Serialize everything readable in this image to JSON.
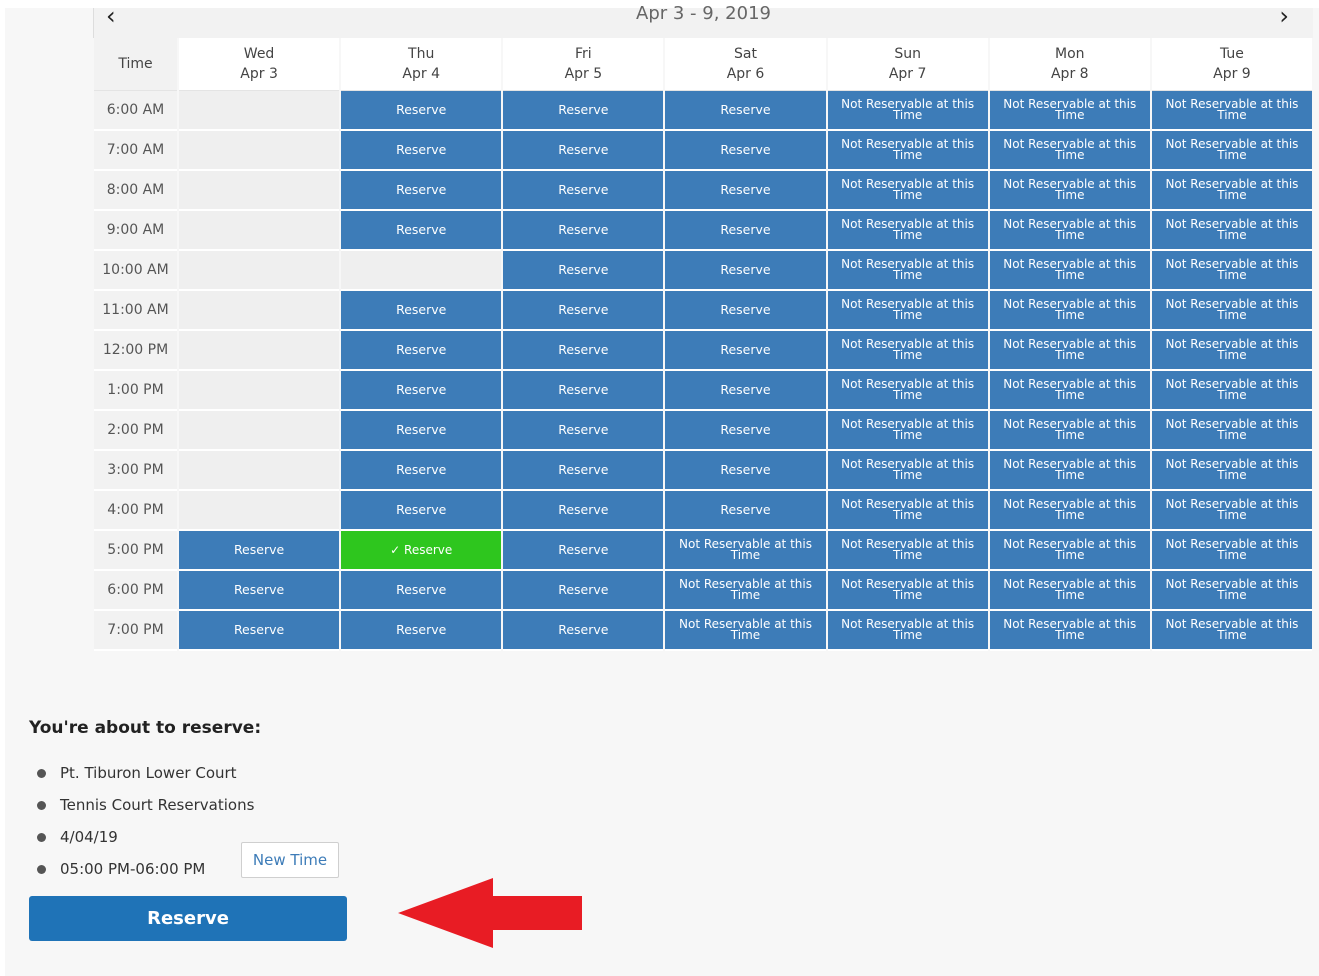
{
  "calendar": {
    "range_label": "Apr 3 - 9, 2019",
    "prev_icon": "‹",
    "next_icon": "›",
    "time_header": "Time",
    "days": [
      {
        "dow": "Wed",
        "date": "Apr 3"
      },
      {
        "dow": "Thu",
        "date": "Apr 4"
      },
      {
        "dow": "Fri",
        "date": "Apr 5"
      },
      {
        "dow": "Sat",
        "date": "Apr 6"
      },
      {
        "dow": "Sun",
        "date": "Apr 7"
      },
      {
        "dow": "Mon",
        "date": "Apr 8"
      },
      {
        "dow": "Tue",
        "date": "Apr 9"
      }
    ],
    "slot_labels": {
      "R": "Reserve",
      "S": "✓ Reserve",
      "N1": "Not Reservable at this",
      "N2": "Time",
      "E": ""
    },
    "rows": [
      {
        "time": "6:00 AM",
        "slots": [
          "E",
          "R",
          "R",
          "R",
          "N",
          "N",
          "N"
        ]
      },
      {
        "time": "7:00 AM",
        "slots": [
          "E",
          "R",
          "R",
          "R",
          "N",
          "N",
          "N"
        ]
      },
      {
        "time": "8:00 AM",
        "slots": [
          "E",
          "R",
          "R",
          "R",
          "N",
          "N",
          "N"
        ]
      },
      {
        "time": "9:00 AM",
        "slots": [
          "E",
          "R",
          "R",
          "R",
          "N",
          "N",
          "N"
        ]
      },
      {
        "time": "10:00 AM",
        "slots": [
          "E",
          "E",
          "R",
          "R",
          "N",
          "N",
          "N"
        ]
      },
      {
        "time": "11:00 AM",
        "slots": [
          "E",
          "R",
          "R",
          "R",
          "N",
          "N",
          "N"
        ]
      },
      {
        "time": "12:00 PM",
        "slots": [
          "E",
          "R",
          "R",
          "R",
          "N",
          "N",
          "N"
        ]
      },
      {
        "time": "1:00 PM",
        "slots": [
          "E",
          "R",
          "R",
          "R",
          "N",
          "N",
          "N"
        ]
      },
      {
        "time": "2:00 PM",
        "slots": [
          "E",
          "R",
          "R",
          "R",
          "N",
          "N",
          "N"
        ]
      },
      {
        "time": "3:00 PM",
        "slots": [
          "E",
          "R",
          "R",
          "R",
          "N",
          "N",
          "N"
        ]
      },
      {
        "time": "4:00 PM",
        "slots": [
          "E",
          "R",
          "R",
          "R",
          "N",
          "N",
          "N"
        ]
      },
      {
        "time": "5:00 PM",
        "slots": [
          "R",
          "S",
          "R",
          "N",
          "N",
          "N",
          "N"
        ]
      },
      {
        "time": "6:00 PM",
        "slots": [
          "R",
          "R",
          "R",
          "N",
          "N",
          "N",
          "N"
        ]
      },
      {
        "time": "7:00 PM",
        "slots": [
          "R",
          "R",
          "R",
          "N",
          "N",
          "N",
          "N"
        ]
      }
    ],
    "colors": {
      "reserve": "#3d7cb8",
      "selected": "#2ec61e",
      "empty": "#efefef"
    }
  },
  "summary": {
    "title": "You're about to reserve:",
    "items": [
      "Pt. Tiburon Lower Court",
      "Tennis Court Reservations",
      "4/04/19",
      "05:00 PM-06:00 PM"
    ],
    "new_time_label": "New Time",
    "reserve_label": "Reserve",
    "arrow_color": "#e81c24"
  }
}
